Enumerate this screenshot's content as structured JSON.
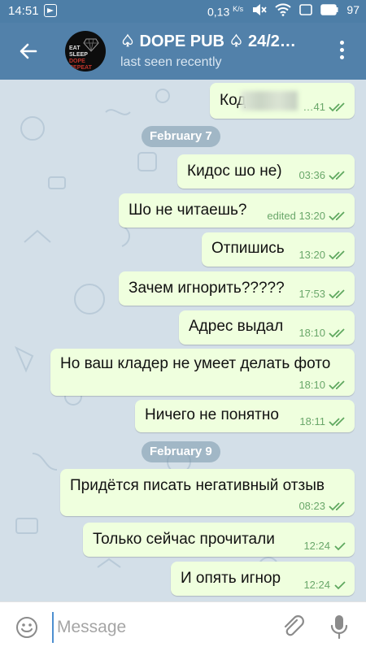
{
  "status_bar": {
    "time": "14:51",
    "speed": "0,13",
    "speed_unit": "K/s",
    "battery": "97"
  },
  "header": {
    "title": "♤ DOPE PUB ♤ 24/2…",
    "subtitle": "last seen recently",
    "avatar_text": [
      "EAT",
      "SLEEP",
      "DOPE",
      "REPEAT"
    ]
  },
  "messages": [
    {
      "text": "Код",
      "time": "…41",
      "status": "read"
    },
    {
      "text": "Кидос шо не)",
      "time": "03:36",
      "status": "read"
    },
    {
      "text": "Шо не читаешь?",
      "time": "edited 13:20",
      "status": "read"
    },
    {
      "text": "Отпишись",
      "time": "13:20",
      "status": "read"
    },
    {
      "text": "Зачем игнорить?????",
      "time": "17:53",
      "status": "read"
    },
    {
      "text": "Адрес выдал",
      "time": "18:10",
      "status": "read"
    },
    {
      "text": "Но ваш кладер не умеет делать фото",
      "time": "18:10",
      "status": "read"
    },
    {
      "text": "Ничего не понятно",
      "time": "18:11",
      "status": "read"
    },
    {
      "text": "Придётся писать негативный отзыв",
      "time": "08:23",
      "status": "read"
    },
    {
      "text": "Только сейчас прочитали",
      "time": "12:24",
      "status": "sent"
    },
    {
      "text": "И опять игнор",
      "time": "12:24",
      "status": "sent"
    }
  ],
  "dates": [
    "February 7",
    "February 9"
  ],
  "input": {
    "placeholder": "Message"
  },
  "colors": {
    "header": "#5281aa",
    "statusbar": "#4d7ea7",
    "bubble": "#efffde",
    "check": "#5fa85f"
  },
  "icons": {
    "back": "arrow-left-icon",
    "menu": "more-vert-icon",
    "emoji": "smile-icon",
    "attach": "paperclip-icon",
    "mic": "microphone-icon"
  }
}
